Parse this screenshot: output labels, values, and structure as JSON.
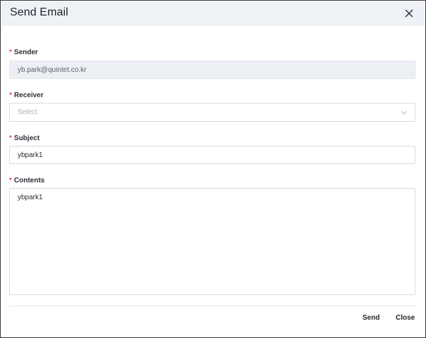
{
  "dialog": {
    "title": "Send Email",
    "close_icon": "close-icon"
  },
  "form": {
    "required_mark": "*",
    "sender": {
      "label": "Sender",
      "value": "yb.park@quintet.co.kr"
    },
    "receiver": {
      "label": "Receiver",
      "placeholder": "Select",
      "icon": "chevron-down-icon"
    },
    "subject": {
      "label": "Subject",
      "value": "ybpark1"
    },
    "contents": {
      "label": "Contents",
      "value": "ybpark1"
    }
  },
  "footer": {
    "send_label": "Send",
    "close_label": "Close"
  },
  "colors": {
    "header_bg": "#eef1f6",
    "required": "#e04a3a",
    "disabled_bg": "#eceff3",
    "border": "#d6dbe2"
  }
}
